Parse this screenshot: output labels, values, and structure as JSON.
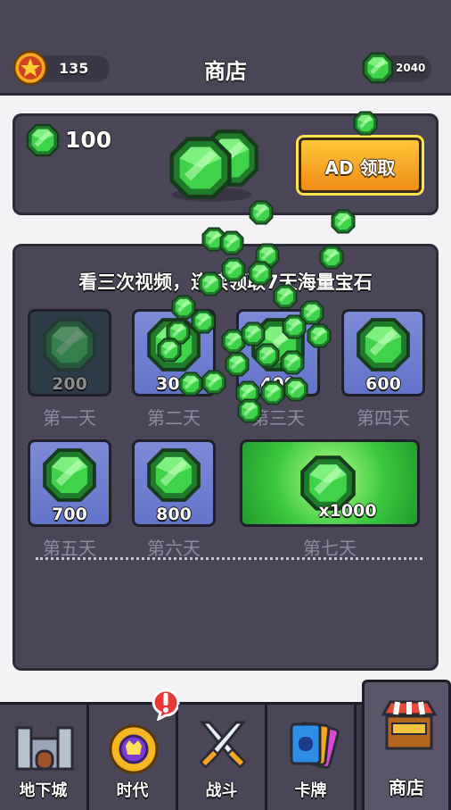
{
  "header": {
    "title": "商店",
    "star_count": "135",
    "gem_count": "2040"
  },
  "ad_panel": {
    "amount": "100",
    "button_label": "AD 领取"
  },
  "weekly": {
    "headline": "看三次视频，连续领取7天海量宝石",
    "days": [
      {
        "amount": "200",
        "label": "第一天",
        "claimed": true
      },
      {
        "amount": "300",
        "label": "第二天",
        "claimed": false
      },
      {
        "amount": "400",
        "label": "第三天",
        "claimed": false
      },
      {
        "amount": "600",
        "label": "第四天",
        "claimed": false
      },
      {
        "amount": "700",
        "label": "第五天",
        "claimed": false
      },
      {
        "amount": "800",
        "label": "第六天",
        "claimed": false
      },
      {
        "amount": "x1000",
        "label": "第七天",
        "claimed": false
      }
    ]
  },
  "nav": [
    {
      "label": "地下城",
      "icon": "castle-icon"
    },
    {
      "label": "时代",
      "icon": "crown-badge-icon"
    },
    {
      "label": "战斗",
      "icon": "crossed-swords-icon"
    },
    {
      "label": "卡牌",
      "icon": "cards-icon"
    },
    {
      "label": "商店",
      "icon": "shop-stall-icon",
      "active": true
    }
  ],
  "colors": {
    "gem": "#3fd24b",
    "ad_button": "#f5a623",
    "panel": "#4a4658",
    "card": "#6f7fd3",
    "alert": "#e53935"
  }
}
